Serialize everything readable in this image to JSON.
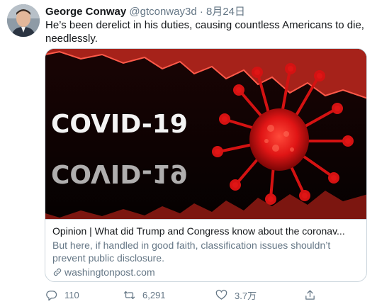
{
  "tweet": {
    "author_name": "George Conway",
    "handle": "@gtconway3d",
    "separator": "·",
    "date": "8月24日",
    "text": "He’s been derelict in his duties, causing countless Americans to die, needlessly."
  },
  "card": {
    "image_text": "COVID-19",
    "image_reflection_text": "COVID-19",
    "title": "Opinion | What did Trump and Congress know about the coronav...",
    "description": "But here, if handled in good faith, classification issues shouldn’t prevent public disclosure.",
    "domain": "washingtonpost.com",
    "domain_icon": "link-icon"
  },
  "actions": {
    "reply_count": "110",
    "retweet_count": "6,291",
    "like_count": "3.7万",
    "reply_icon": "reply-icon",
    "retweet_icon": "retweet-icon",
    "like_icon": "heart-icon",
    "share_icon": "share-icon"
  },
  "colors": {
    "text": "#14171a",
    "secondary": "#657786",
    "border": "#ccd6dd",
    "virus_red": "#e01515"
  }
}
